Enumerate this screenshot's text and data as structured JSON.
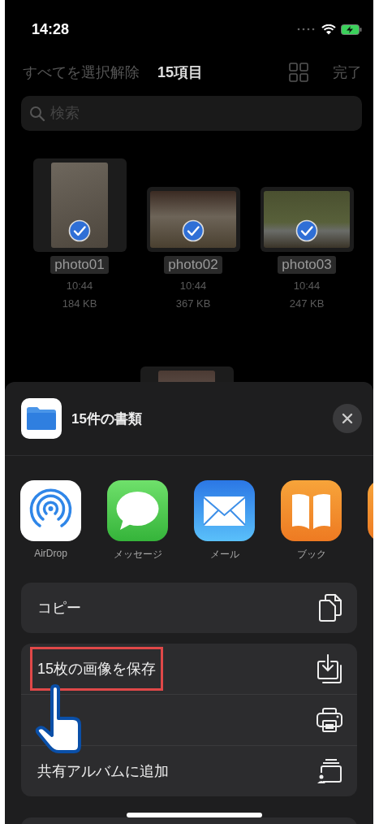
{
  "status_bar": {
    "time": "14:28"
  },
  "nav": {
    "deselect_all": "すべてを選択解除",
    "title": "15項目",
    "done": "完了"
  },
  "search": {
    "placeholder": "検索"
  },
  "files": [
    {
      "name": "photo01",
      "time": "10:44",
      "size": "184 KB",
      "selected": true,
      "kind": "portrait"
    },
    {
      "name": "photo02",
      "time": "10:44",
      "size": "367 KB",
      "selected": true,
      "kind": "landscape"
    },
    {
      "name": "photo03",
      "time": "10:44",
      "size": "247 KB",
      "selected": true,
      "kind": "landscape"
    }
  ],
  "share_sheet": {
    "title": "15件の書類",
    "apps": [
      {
        "kind": "airdrop",
        "label": "AirDrop"
      },
      {
        "kind": "messages",
        "label": "メッセージ"
      },
      {
        "kind": "mail",
        "label": "メール"
      },
      {
        "kind": "books",
        "label": "ブック"
      },
      {
        "kind": "cut_off"
      }
    ],
    "action_groups": [
      [
        {
          "kind": "copy",
          "label": "コピー",
          "highlighted": false
        }
      ],
      [
        {
          "kind": "save",
          "label": "15枚の画像を保存",
          "highlighted": true
        },
        {
          "kind": "print",
          "highlighted": false
        },
        {
          "kind": "shared_album",
          "label": "共有アルバムに追加",
          "highlighted": false
        }
      ]
    ]
  }
}
